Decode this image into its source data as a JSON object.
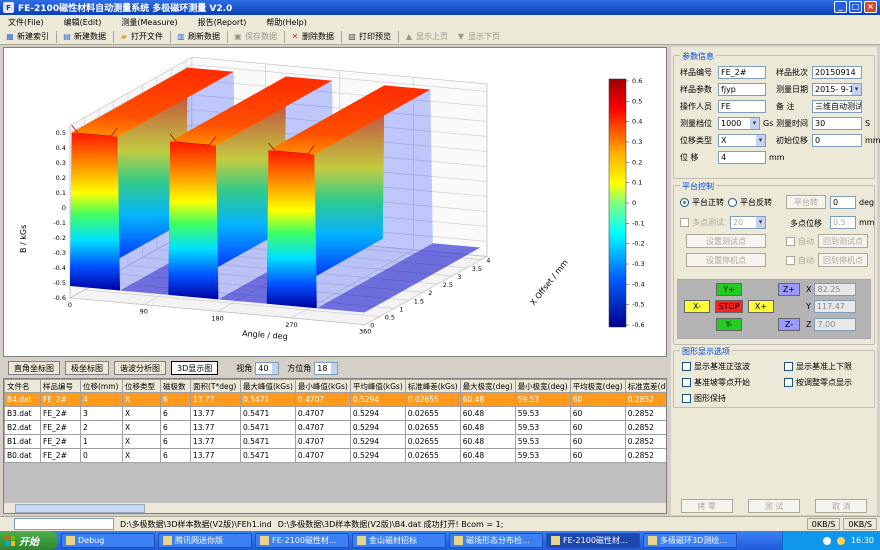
{
  "window": {
    "title": "FE-2100磁性材料自动测量系统  多极磁环测量 V2.0"
  },
  "menu": [
    "文件(File)",
    "编辑(Edit)",
    "测量(Measure)",
    "报告(Report)",
    "帮助(Help)"
  ],
  "toolbar": [
    {
      "label": "新建索引",
      "icon": "index-icon",
      "enabled": true
    },
    {
      "label": "新建数据",
      "icon": "new-data-icon",
      "enabled": true
    },
    {
      "label": "打开文件",
      "icon": "open-folder-icon",
      "enabled": true
    },
    {
      "label": "刷新数据",
      "icon": "refresh-icon",
      "enabled": true
    },
    {
      "label": "保存数据",
      "icon": "save-icon",
      "enabled": false
    },
    {
      "label": "删除数据",
      "icon": "delete-icon",
      "enabled": true
    },
    {
      "label": "打印预览",
      "icon": "print-preview-icon",
      "enabled": true
    },
    {
      "label": "显示上页",
      "icon": "page-up-icon",
      "enabled": false
    },
    {
      "label": "显示下页",
      "icon": "page-down-icon",
      "enabled": false
    }
  ],
  "chart_data": {
    "type": "surface3d",
    "zlabel": "B / kGs",
    "xlabel": "Angle / deg",
    "ylabel": "X Offset / mm",
    "x_ticks": [
      0,
      90,
      180,
      270,
      360
    ],
    "y_ticks": [
      0,
      0.5,
      1,
      1.5,
      2,
      2.5,
      3,
      3.5,
      4
    ],
    "z_ticks": [
      -0.6,
      -0.5,
      -0.4,
      -0.3,
      -0.2,
      -0.1,
      0,
      0.1,
      0.2,
      0.3,
      0.4,
      0.5
    ],
    "colorbar_ticks": [
      "0.6",
      "0.5",
      "0.4",
      "0.3",
      "0.2",
      "0.1",
      "0",
      "-0.1",
      "-0.2",
      "-0.3",
      "-0.4",
      "-0.5",
      "-0.6"
    ],
    "colorbar_range": [
      -0.6,
      0.6
    ],
    "poles": 6,
    "peak_value": 0.5471,
    "valley_value": 0.4707
  },
  "view_buttons": {
    "rect": "直角坐标图",
    "polar": "极坐标图",
    "harmonic": "谐波分析图",
    "three_d": "3D显示图"
  },
  "view": {
    "elev_label": "视角",
    "elev_value": "40",
    "azim_label": "方位角",
    "azim_value": "18"
  },
  "table": {
    "columns": [
      "文件名",
      "样品编号",
      "位移(mm)",
      "位移类型",
      "磁极数",
      "面积(T*deg)",
      "最大峰值(kGs)",
      "最小峰值(kGs)",
      "平均峰值(kGs)",
      "标准峰差(kGs)",
      "最大极宽(deg)",
      "最小极宽(deg)",
      "平均极宽(deg)",
      "标准宽差(deg)"
    ],
    "rows": [
      [
        "B4.dat",
        "FE_2#",
        "4",
        "X",
        "6",
        "13.77",
        "0.5471",
        "0.4707",
        "0.5294",
        "0.02655",
        "60.48",
        "59.53",
        "60",
        "0.2852"
      ],
      [
        "B3.dat",
        "FE_2#",
        "3",
        "X",
        "6",
        "13.77",
        "0.5471",
        "0.4707",
        "0.5294",
        "0.02655",
        "60.48",
        "59.53",
        "60",
        "0.2852"
      ],
      [
        "B2.dat",
        "FE_2#",
        "2",
        "X",
        "6",
        "13.77",
        "0.5471",
        "0.4707",
        "0.5294",
        "0.02655",
        "60.48",
        "59.53",
        "60",
        "0.2852"
      ],
      [
        "B1.dat",
        "FE_2#",
        "1",
        "X",
        "6",
        "13.77",
        "0.5471",
        "0.4707",
        "0.5294",
        "0.02655",
        "60.48",
        "59.53",
        "60",
        "0.2852"
      ],
      [
        "B0.dat",
        "FE_2#",
        "0",
        "X",
        "6",
        "13.77",
        "0.5471",
        "0.4707",
        "0.5294",
        "0.02655",
        "60.48",
        "59.53",
        "60",
        "0.2852"
      ]
    ],
    "selected_row": 0
  },
  "params": {
    "title": "参数信息",
    "sample_no_label": "样品编号",
    "sample_no": "FE_2#",
    "batch_label": "样品批次",
    "batch": "20150914",
    "model_label": "样品参数",
    "model": "fjyp",
    "date_label": "测量日期",
    "date": "2015- 9-14",
    "operator_label": "操作人员",
    "operator": "FE",
    "remark_label": "备    注",
    "remark": "三维自动测试",
    "range_label": "测量档位",
    "range": "1000",
    "range_unit": "Gs",
    "time_label": "测量时间",
    "time": "30",
    "time_unit": "S",
    "disp_type_label": "位移类型",
    "disp_type": "X",
    "init_label": "初始位移",
    "init": "0",
    "init_unit": "mm",
    "disp_label": "位    移",
    "disp": "4",
    "disp_unit": "mm"
  },
  "platform": {
    "title": "平台控制",
    "forward": "平台正转",
    "reverse": "平台反转",
    "rotate_btn": "平台转",
    "rotate_value": "0",
    "rotate_unit": "deg",
    "multi_test": "多点测试",
    "multi_count": "20",
    "multi_disp_label": "多点位移",
    "multi_disp": "0.5",
    "multi_disp_unit": "mm",
    "set_test_point": "设置测试点",
    "set_stop_point": "设置停机点",
    "auto1": "自动",
    "auto2": "自动",
    "return_test": "回到测试点",
    "return_stop": "回到停机点",
    "pad": {
      "y_plus": "Y+",
      "y_minus": "Y-",
      "x_minus": "X-",
      "x_plus": "X+",
      "stop": "STOP",
      "z_plus": "Z+",
      "z_minus": "Z-"
    },
    "coords": {
      "x_label": "X",
      "x": "82.25",
      "y_label": "Y",
      "y": "117.47",
      "z_label": "Z",
      "z": "7.00"
    }
  },
  "display": {
    "title": "图形显示选项",
    "opt1": "显示基准正弦波",
    "opt2": "显示基准上下限",
    "opt3": "基准坡零点开始",
    "opt4": "按调整零点显示",
    "opt5": "图形保持"
  },
  "bottom": {
    "copy": "拷 零",
    "test": "测 试",
    "cancel": "取 消"
  },
  "status": {
    "path1": "D:\\多极数据\\3D样本数据(V2版)\\FEh1.ind",
    "msg": "D:\\多极数据\\3D样本数据(V2版)\\B4.dat 成功打开! Bcom = 1;",
    "net1": "0KB/S",
    "net2": "0KB/S"
  },
  "taskbar": {
    "start": "开始",
    "tasks": [
      "Debug",
      "腾讯网迷你版",
      "FE-2100磁性材...",
      "金山磁材招标",
      "磁场形态分布检...",
      "FE-2100磁性材...",
      "多极磁环3D测绘..."
    ],
    "active": 5,
    "clock": "16:30"
  }
}
